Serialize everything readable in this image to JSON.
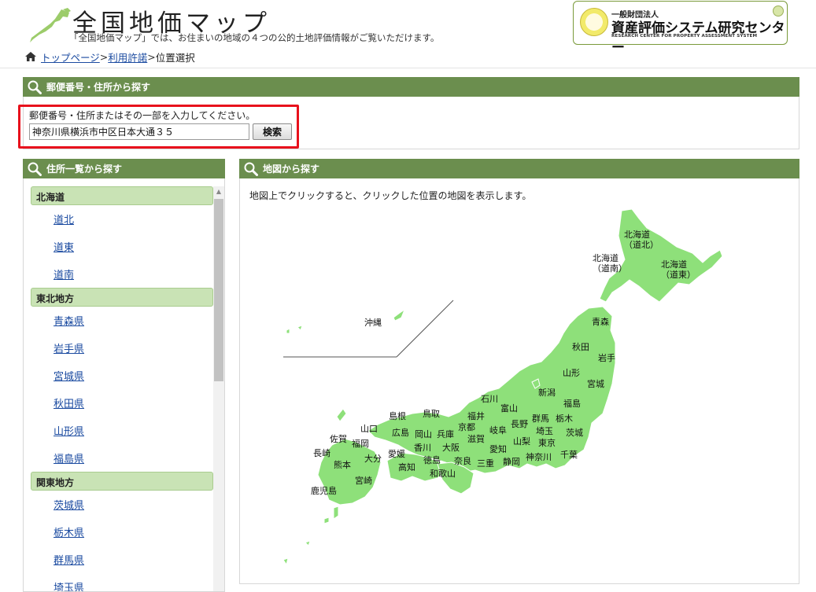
{
  "header": {
    "title": "全国地価マップ",
    "subtitle": "「全国地価マップ」では、お住まいの地域の４つの公的土地評価情報がご覧いただけます。",
    "org": {
      "prefix": "一般財団法人",
      "name": "資産評価システム研究センター",
      "english": "RESEARCH CENTER FOR PROPERTY ASSESSMENT SYSTEM"
    }
  },
  "breadcrumb": {
    "home": "トップページ",
    "terms": "利用許諾",
    "current": "位置選択",
    "sep": ">"
  },
  "search": {
    "heading": "郵便番号・住所から探す",
    "label": "郵便番号・住所またはその一部を入力してください。",
    "value": "神奈川県横浜市中区日本大通３５",
    "button": "検索"
  },
  "list": {
    "heading": "住所一覧から探す",
    "regions": [
      {
        "name": "北海道",
        "items": [
          "道北",
          "道東",
          "道南"
        ]
      },
      {
        "name": "東北地方",
        "items": [
          "青森県",
          "岩手県",
          "宮城県",
          "秋田県",
          "山形県",
          "福島県"
        ]
      },
      {
        "name": "関東地方",
        "items": [
          "茨城県",
          "栃木県",
          "群馬県",
          "埼玉県"
        ]
      }
    ]
  },
  "map": {
    "heading": "地図から探す",
    "description": "地図上でクリックすると、クリックした位置の地図を表示します。",
    "labels": {
      "hokkaido_north_1": "北海道",
      "hokkaido_north_2": "（道北）",
      "hokkaido_south_1": "北海道",
      "hokkaido_south_2": "（道南）",
      "hokkaido_east_1": "北海道",
      "hokkaido_east_2": "（道東）",
      "okinawa": "沖縄",
      "aomori": "青森",
      "akita": "秋田",
      "iwate": "岩手",
      "yamagata": "山形",
      "miyagi": "宮城",
      "niigata": "新潟",
      "fukushima": "福島",
      "ishikawa": "石川",
      "toyama": "富山",
      "gunma": "群馬",
      "tochigi": "栃木",
      "shimane": "島根",
      "tottori": "鳥取",
      "fukui": "福井",
      "kyoto": "京都",
      "nagano": "長野",
      "saitama": "埼玉",
      "ibaraki": "茨城",
      "yamaguchi": "山口",
      "hiroshima": "広島",
      "okayama": "岡山",
      "hyogo": "兵庫",
      "shiga": "滋賀",
      "gifu": "岐阜",
      "tokyo": "東京",
      "yamanashi": "山梨",
      "saga": "佐賀",
      "fukuoka": "福岡",
      "kagawa": "香川",
      "osaka": "大阪",
      "aichi": "愛知",
      "nagasaki": "長崎",
      "ehime": "愛媛",
      "oita": "大分",
      "tokushima": "徳島",
      "nara": "奈良",
      "kanagawa": "神奈川",
      "chiba": "千葉",
      "kumamoto": "熊本",
      "kochi": "高知",
      "mie": "三重",
      "shizuoka": "静岡",
      "wakayama": "和歌山",
      "miyazaki": "宮崎",
      "kagoshima": "鹿児島"
    }
  },
  "colors": {
    "panel_header": "#6b8e4e",
    "map_land": "#8ee07a",
    "region_bar": "#c9e3b5",
    "highlight": "#e8111c",
    "link": "#1a4aa0"
  }
}
